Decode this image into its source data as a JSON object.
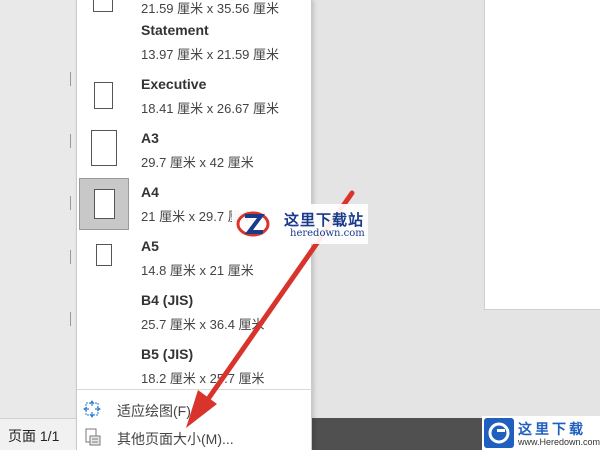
{
  "page_sizes": [
    {
      "name": "",
      "dims": "21.59 厘米 x 35.56 厘米",
      "selected": false
    },
    {
      "name": "Statement",
      "dims": "13.97 厘米 x 21.59 厘米",
      "selected": false
    },
    {
      "name": "Executive",
      "dims": "18.41 厘米 x 26.67 厘米",
      "selected": false
    },
    {
      "name": "A3",
      "dims": "29.7 厘米 x 42 厘米",
      "selected": false
    },
    {
      "name": "A4",
      "dims": "21 厘米 x 29.7 厘米",
      "selected": true
    },
    {
      "name": "A5",
      "dims": "14.8 厘米 x 21 厘米",
      "selected": false
    },
    {
      "name": "B4 (JIS)",
      "dims": "25.7 厘米 x 36.4 厘米",
      "selected": false
    },
    {
      "name": "B5 (JIS)",
      "dims": "18.2 厘米 x 25.7 厘米",
      "selected": false
    }
  ],
  "actions": {
    "fit_drawing": "适应绘图(F)",
    "more_sizes": "其他页面大小(M)..."
  },
  "status_bar": {
    "page_indicator": "页面 1/1"
  },
  "watermark": {
    "center_title": "这里下载站",
    "center_url": "heredown.com",
    "corner_title": "这里下载",
    "corner_url": "www.Heredown.com"
  },
  "colors": {
    "arrow": "#d9342b",
    "watermark_blue": "#1f5fbf",
    "selected_bg": "#c8c8c8"
  }
}
